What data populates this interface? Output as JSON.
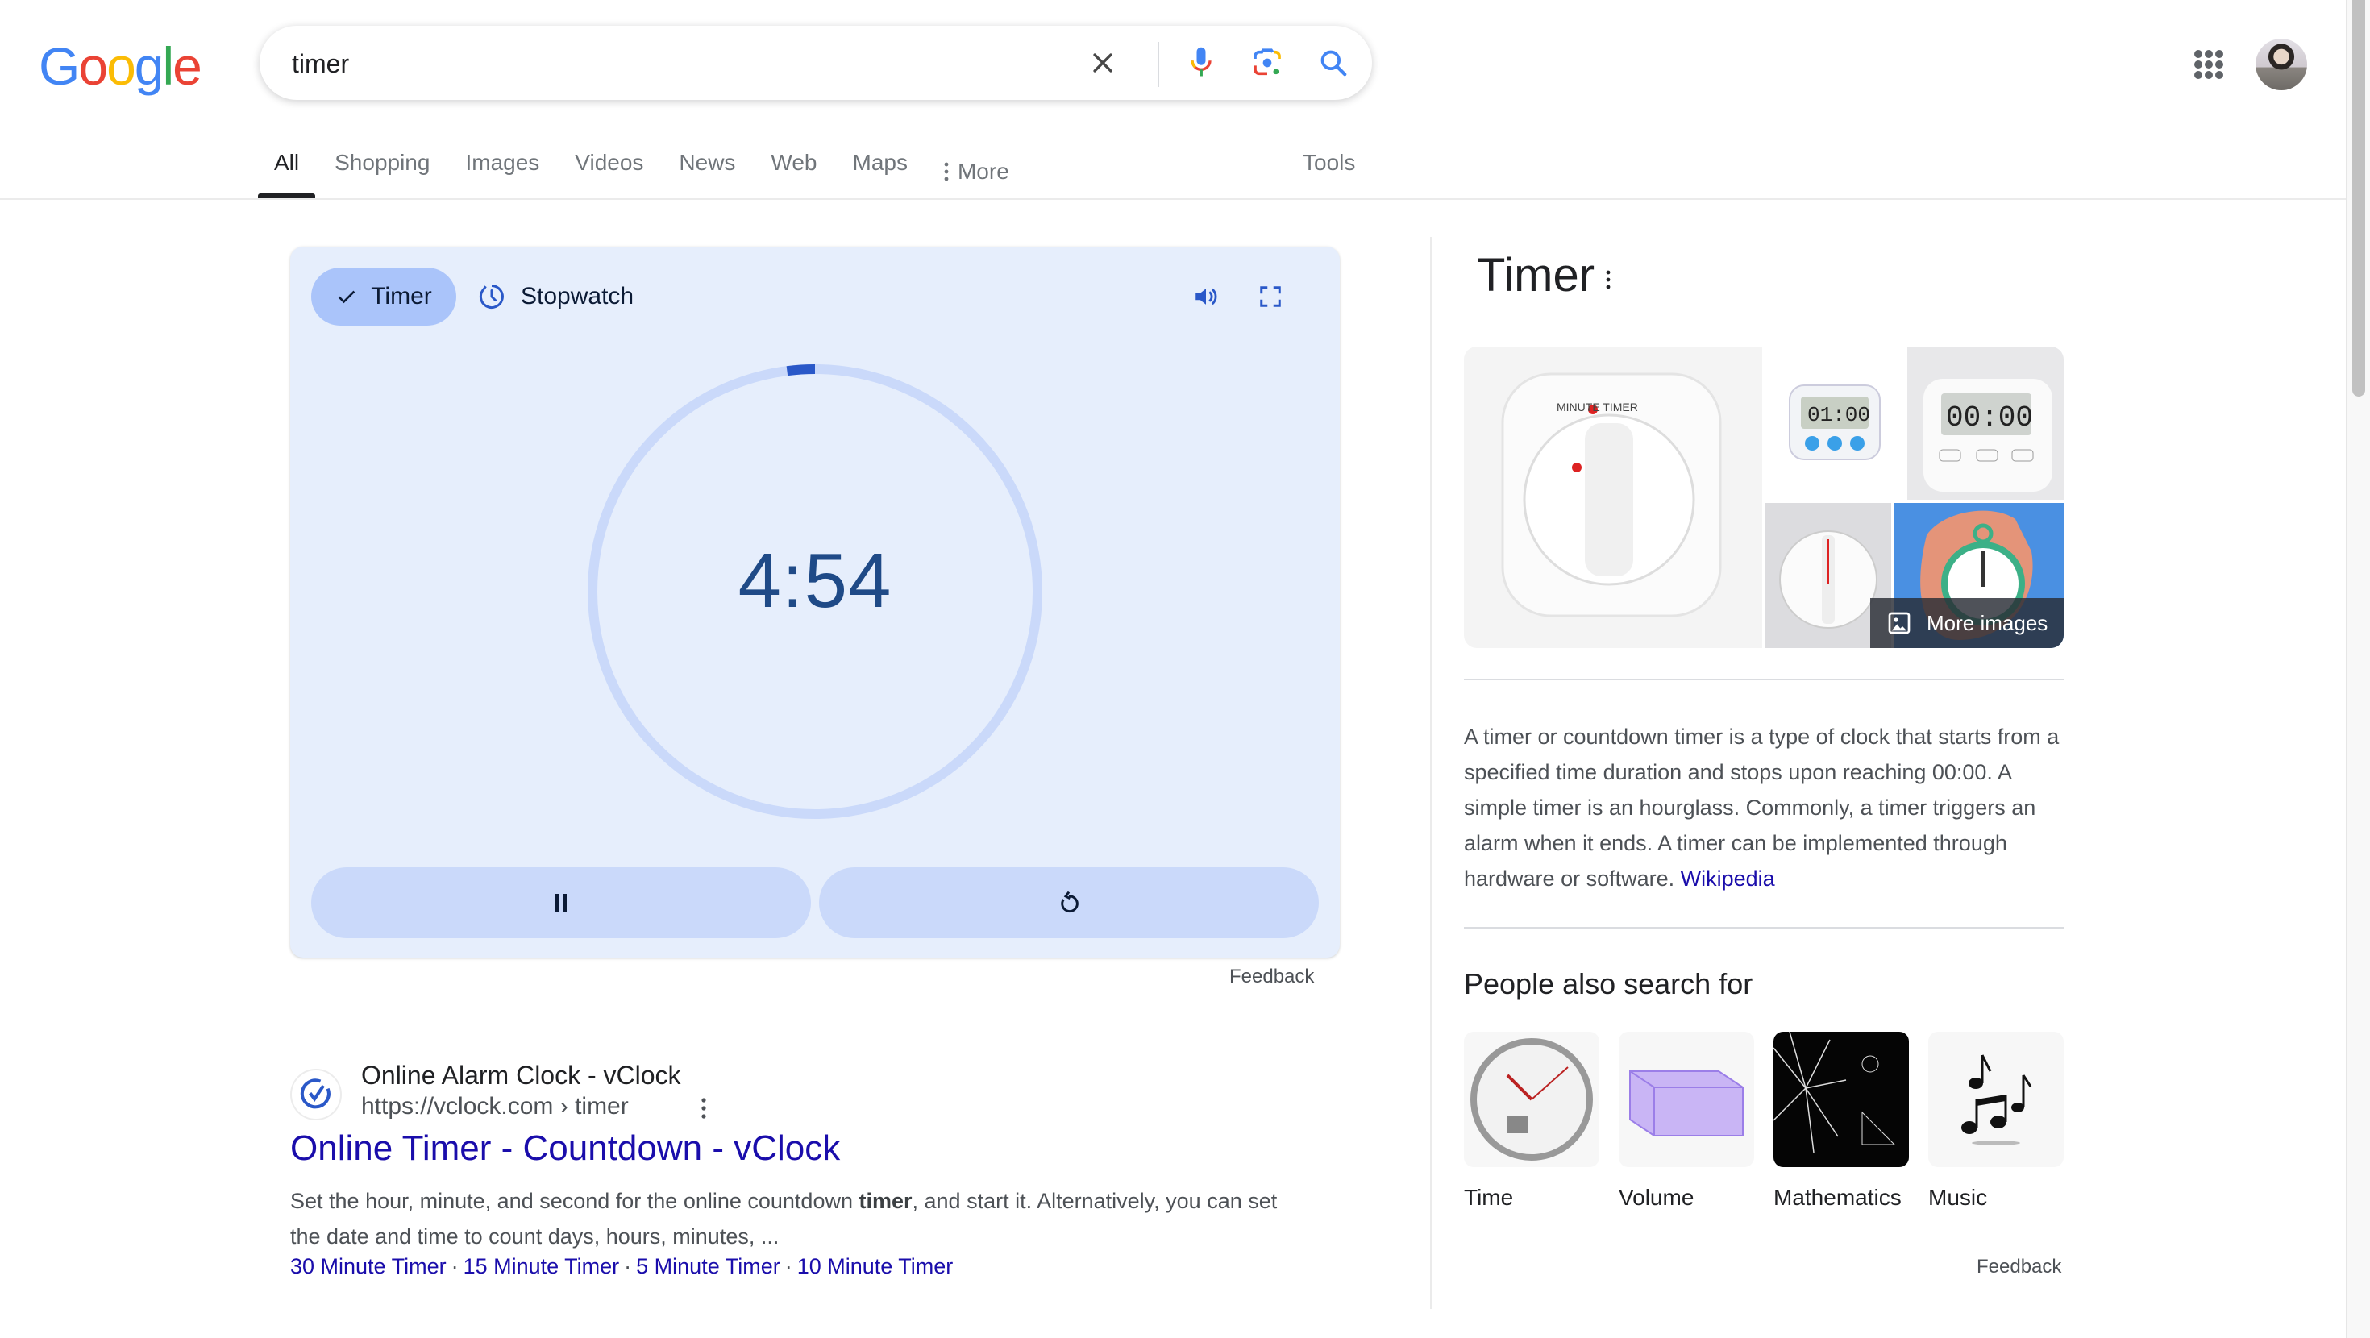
{
  "header": {
    "logo_letters": [
      {
        "char": "G",
        "color": "#4285F4"
      },
      {
        "char": "o",
        "color": "#EA4335"
      },
      {
        "char": "o",
        "color": "#FBBC05"
      },
      {
        "char": "g",
        "color": "#4285F4"
      },
      {
        "char": "l",
        "color": "#34A853"
      },
      {
        "char": "e",
        "color": "#EA4335"
      }
    ],
    "search": {
      "value": "timer",
      "placeholder": ""
    },
    "icons": [
      "clear-icon",
      "microphone-icon",
      "google-lens-icon",
      "search-icon",
      "apps-grid-icon",
      "avatar"
    ]
  },
  "tabs": {
    "items": [
      {
        "label": "All",
        "active": true
      },
      {
        "label": "Shopping"
      },
      {
        "label": "Images"
      },
      {
        "label": "Videos"
      },
      {
        "label": "News"
      },
      {
        "label": "Web"
      },
      {
        "label": "Maps"
      },
      {
        "label": "More",
        "icon": "vertical-dots-icon"
      }
    ],
    "tools": "Tools"
  },
  "timer_widget": {
    "mode_tabs": [
      {
        "label": "Timer",
        "selected": true,
        "icon": "checkmark-icon"
      },
      {
        "label": "Stopwatch",
        "selected": false,
        "icon": "stopwatch-icon"
      }
    ],
    "time_remaining": "4:54",
    "total_seconds": 300,
    "elapsed_seconds": 6,
    "progress_fraction_elapsed": 0.02,
    "colors": {
      "card_bg": "#e6eefc",
      "ring_track": "#cad9fa",
      "ring_progress": "#2a58c8",
      "time_text": "#1f4a87",
      "button_bg": "#cad9fa",
      "pill_selected": "#aac4fa"
    },
    "controls": [
      "pause-icon",
      "reset-icon"
    ],
    "side_icons": [
      "volume-icon",
      "fullscreen-icon"
    ],
    "feedback": "Feedback"
  },
  "result": {
    "site_name": "Online Alarm Clock - vClock",
    "url": "https://vclock.com › timer",
    "title": "Online Timer - Countdown - vClock",
    "snippet_before": "Set the hour, minute, and second for the online countdown ",
    "snippet_bold": "timer",
    "snippet_after": ", and start it. Alternatively, you can set the date and time to count days, hours, minutes, ...",
    "sitelinks": [
      "30 Minute Timer",
      "15 Minute Timer",
      "5 Minute Timer",
      "10 Minute Timer"
    ]
  },
  "knowledge_panel": {
    "title": "Timer",
    "images": [
      {
        "alt": "Farberware minute timer",
        "caption_text": "MINUTE TIMER"
      },
      {
        "alt": "Digital kitchen timer",
        "display": "01:00"
      },
      {
        "alt": "Square digital timer",
        "display": "00:00"
      },
      {
        "alt": "Round mechanical timer"
      },
      {
        "alt": "Hand holding stopwatch illustration"
      }
    ],
    "more_images": "More images",
    "description": "A timer or countdown timer is a type of clock that starts from a specified time duration and stops upon reaching 00:00. A simple timer is an hourglass. Commonly, a timer triggers an alarm when it ends. A timer can be implemented through hardware or software.",
    "source_link": "Wikipedia",
    "people_also_search_heading": "People also search for",
    "people_also_search": [
      {
        "label": "Time"
      },
      {
        "label": "Volume"
      },
      {
        "label": "Mathematics"
      },
      {
        "label": "Music"
      }
    ],
    "feedback": "Feedback"
  }
}
